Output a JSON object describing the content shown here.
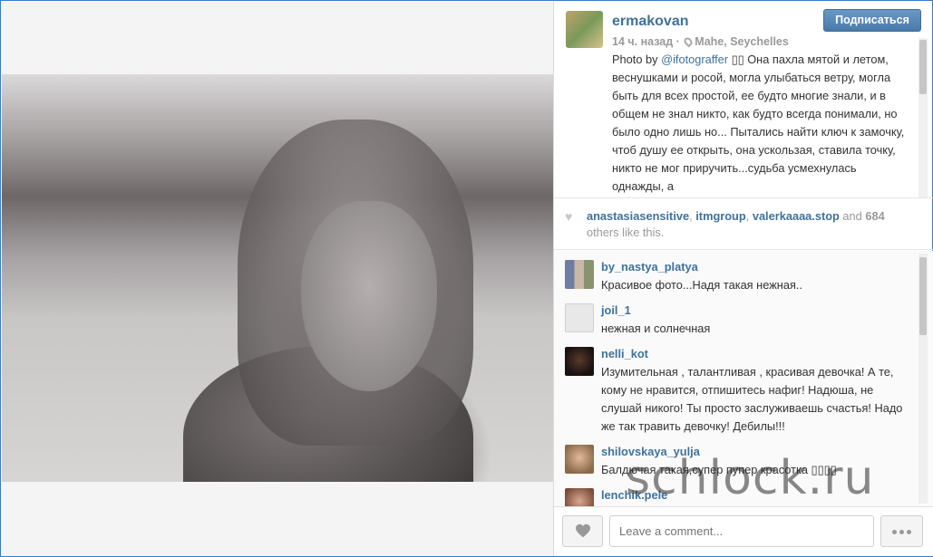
{
  "post": {
    "username": "ermakovan",
    "follow_label": "Подписаться",
    "time": "14 ч. назад",
    "location": "Mahe, Seychelles",
    "caption_prefix": "Photo by ",
    "caption_mention": "@ifotograffer",
    "caption_text": " ▯▯ Она пахла мятой и летом, веснушками и росой, могла улыбаться ветру, могла быть для всех простой, ее будто многие знали, и в общем не знал никто, как будто всегда понимали, но было одно лишь но... Пытались найти ключ к замочку, чтоб душу ее открыть, она ускользая, ставила точку, никто не мог приручить...судьба усмехнулась однажды, а"
  },
  "likes": {
    "user1": "anastasiasensitive",
    "sep1": ", ",
    "user2": "itmgroup",
    "sep2": ", ",
    "user3": "valerkaaaa.stop",
    "and": " and ",
    "count": "684",
    "suffix": " others like this."
  },
  "comments": [
    {
      "user": "by_nastya_platya",
      "text": "Красивое фото...Надя такая нежная.."
    },
    {
      "user": "joil_1",
      "text": "нежная и солнечная"
    },
    {
      "user": "nelli_kot",
      "text": "Изумительная , талантливая , красивая девочка! А те, кому не нравится, отпишитесь нафиг! Надюша, не слушай никого! Ты просто заслуживаешь счастья! Надо же так травить девочку! Дебилы!!!"
    },
    {
      "user": "shilovskaya_yulja",
      "text": "Балдючая такая,супер пупер красотка ▯▯▯▯"
    },
    {
      "user": "lenchik.pele",
      "text": ""
    }
  ],
  "footer": {
    "comment_placeholder": "Leave a comment..."
  },
  "watermark": "schlock.ru",
  "colors": {
    "link": "#3f729b",
    "follow_button": "#4a7aaa",
    "frame_border": "#3a7bc8"
  },
  "icons": {
    "location": "location-pin-icon",
    "like": "heart-icon",
    "more": "ellipsis-icon"
  }
}
